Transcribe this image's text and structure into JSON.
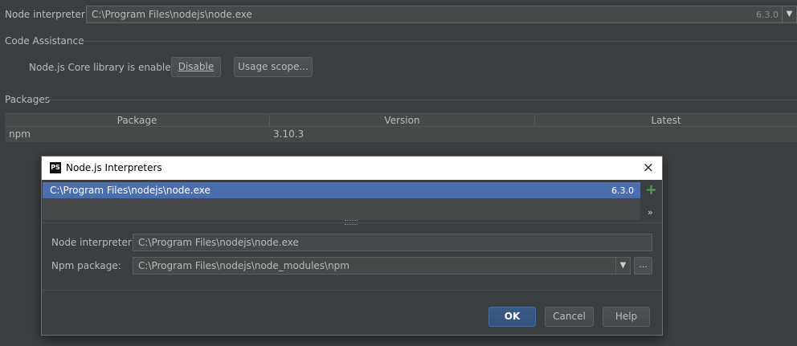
{
  "settings": {
    "node_interpreter_label": "Node interpreter:",
    "node_interpreter_path": "C:\\Program Files\\nodejs\\node.exe",
    "node_interpreter_version": "6.3.0",
    "code_assistance_title": "Code Assistance",
    "core_library_text": "Node.js Core library is enabled.",
    "disable_button": "Disable",
    "usage_scope_button": "Usage scope...",
    "packages_title": "Packages",
    "table": {
      "columns": [
        "Package",
        "Version",
        "Latest"
      ],
      "rows": [
        {
          "package": "npm",
          "version": "3.10.3",
          "latest": ""
        }
      ]
    }
  },
  "dialog": {
    "icon": "PS",
    "title": "Node.js Interpreters",
    "close_icon": "×",
    "interpreters": [
      {
        "path": "C:\\Program Files\\nodejs\\node.exe",
        "version": "6.3.0"
      }
    ],
    "add_icon": "+",
    "more_icon": "»",
    "node_interpreter_label": "Node interpreter:",
    "node_interpreter_value": "C:\\Program Files\\nodejs\\node.exe",
    "npm_package_label": "Npm package:",
    "npm_package_value": "C:\\Program Files\\nodejs\\node_modules\\npm",
    "browse_icon": "...",
    "ok_button": "OK",
    "cancel_button": "Cancel",
    "help_button": "Help"
  },
  "colors": {
    "background": "#3c3f41",
    "selection": "#4b6eaf",
    "ok_button": "#365880",
    "add_icon": "#4aa546"
  }
}
